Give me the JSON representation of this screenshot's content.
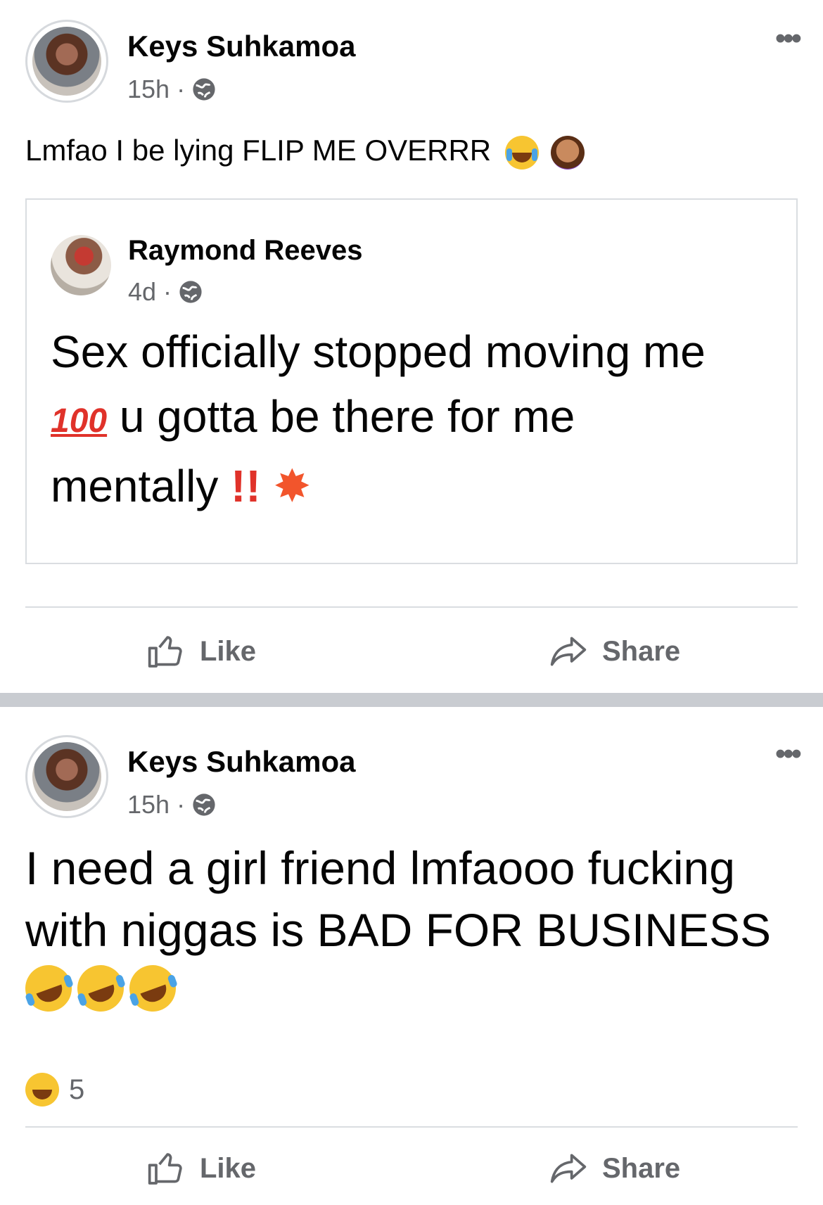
{
  "post1": {
    "author": "Keys Suhkamoa",
    "time": "15h",
    "separator": "·",
    "more": "•••",
    "text": "Lmfao I be lying FLIP ME OVERRR",
    "shared": {
      "author": "Raymond Reeves",
      "time": "4d",
      "separator": "·",
      "line1": "Sex officially stopped moving me",
      "hundred": "100",
      "line2": "u gotta be there for me",
      "line3": "mentally",
      "bang": "!!",
      "boom": "✸"
    },
    "actions": {
      "like": "Like",
      "share": "Share"
    }
  },
  "post2": {
    "author": "Keys Suhkamoa",
    "time": "15h",
    "separator": "·",
    "more": "•••",
    "text": "I need a girl friend lmfaooo fucking with niggas is BAD FOR BUSINESS",
    "reaction_count": "5",
    "actions": {
      "like": "Like",
      "share": "Share"
    }
  },
  "icons": {
    "globe": "globe-icon",
    "like": "thumbs-up-icon",
    "share": "share-arrow-icon",
    "more": "more-dots-icon"
  },
  "colors": {
    "text_primary": "#050505",
    "text_secondary": "#65676b",
    "divider": "#dadde1",
    "feed_separator": "#c9ccd1"
  }
}
